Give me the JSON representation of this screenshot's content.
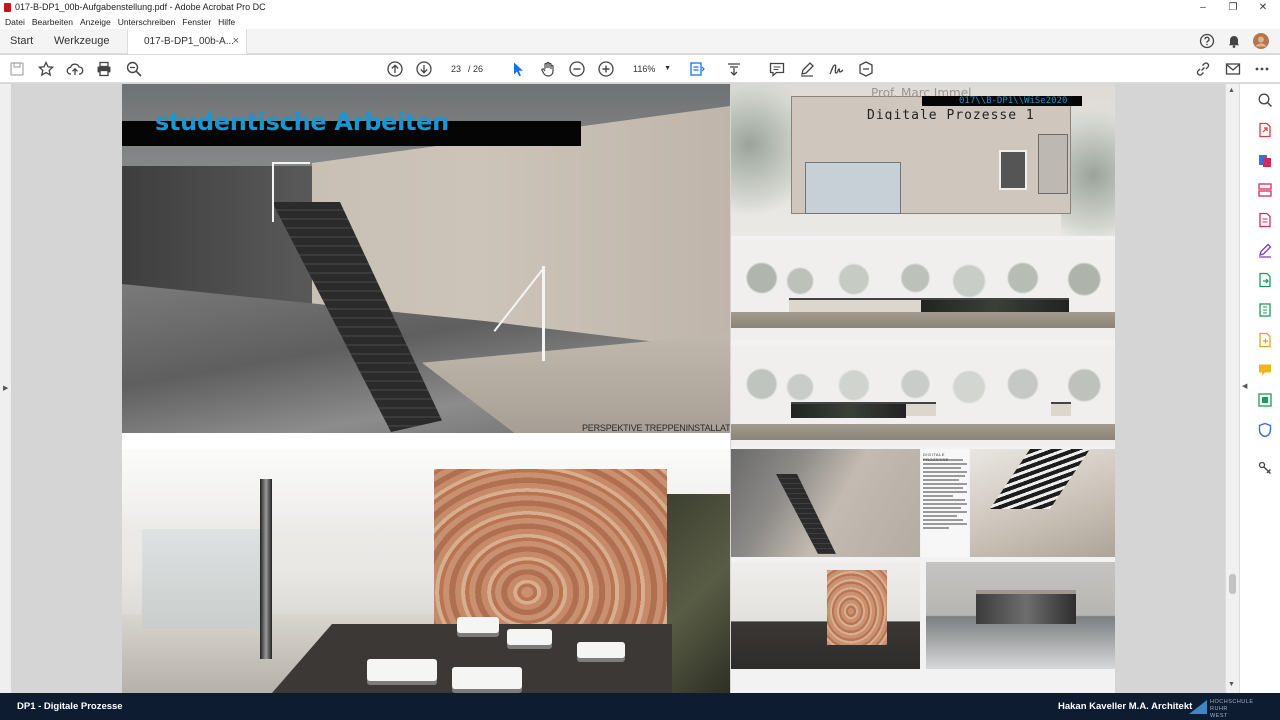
{
  "window": {
    "title": "017-B-DP1_00b-Aufgabenstellung.pdf - Adobe Acrobat Pro DC",
    "controls": [
      "–",
      "❐",
      "✕"
    ]
  },
  "menu": [
    "Datei",
    "Bearbeiten",
    "Anzeige",
    "Unterschreiben",
    "Fenster",
    "Hilfe"
  ],
  "tabs": {
    "home": "Start",
    "tools": "Werkzeuge",
    "document": "017-B-DP1_00b-A...",
    "close": "×"
  },
  "toolbar": {
    "page_current": "23",
    "page_total": "/ 26",
    "zoom": "116%",
    "icons": [
      "save-icon",
      "bookmark-star-icon",
      "upload-cloud-icon",
      "print-icon",
      "search-zoom-icon",
      "previous-page-icon",
      "next-page-icon",
      "select-cursor-icon",
      "hand-tool-icon",
      "zoom-out-icon",
      "zoom-in-icon",
      "fit-page-icon",
      "scroll-mode-icon",
      "comment-icon",
      "highlight-pen-icon",
      "sign-icon",
      "stamp-icon",
      "share-link-icon",
      "email-icon",
      "more-icon"
    ]
  },
  "colors": {
    "accent_blue": "#1b96cf",
    "footer_bg": "#0d1c31",
    "acrobat_red": "#c4141a"
  },
  "document": {
    "left_page": {
      "heading": "studentische Arbeiten",
      "caption": "PERSPEKTIVE TREPPENINSTALLATIO"
    },
    "right_page": {
      "author": "Prof. Marc Immel",
      "code": "017\\\\B-DP1\\\\WiSe2020",
      "title": "Digitale Prozesse 1",
      "description_heading": "DIGITALE PROZESSE"
    }
  },
  "right_tools": [
    "search-zoom-icon",
    "export-pdf-icon",
    "create-pdf-icon",
    "organize-pages-icon",
    "edit-pdf-icon",
    "fill-sign-icon",
    "export-icon",
    "compress-icon",
    "combine-icon",
    "comment-icon",
    "scan-icon",
    "protect-icon",
    "more-tools-icon"
  ],
  "footer": {
    "left": "DP1 - Digitale Prozesse",
    "right": "Hakan Kaveller M.A. Architekt",
    "logo_text": "HOCHSCHULE RUHR WEST"
  }
}
